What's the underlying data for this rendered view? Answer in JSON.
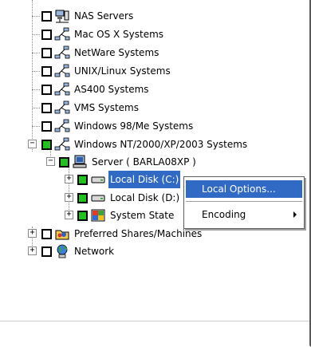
{
  "tree": {
    "items": [
      {
        "label": "NAS Servers",
        "icon": "network-computer-icon"
      },
      {
        "label": "Mac OS X Systems",
        "icon": "network-icon"
      },
      {
        "label": "NetWare Systems",
        "icon": "network-icon"
      },
      {
        "label": "UNIX/Linux Systems",
        "icon": "network-icon"
      },
      {
        "label": "AS400 Systems",
        "icon": "network-icon"
      },
      {
        "label": "VMS Systems",
        "icon": "network-icon"
      },
      {
        "label": "Windows 98/Me Systems",
        "icon": "network-icon"
      },
      {
        "label": "Windows NT/2000/XP/2003 Systems",
        "icon": "network-icon",
        "expander": "−"
      },
      {
        "label": "Server ( BARLA08XP )",
        "icon": "server-icon",
        "expander": "−"
      },
      {
        "label": "Local Disk (C:)",
        "icon": "disk-icon",
        "expander": "+",
        "selected": true
      },
      {
        "label": "Local Disk (D:)",
        "icon": "disk-icon",
        "expander": "+"
      },
      {
        "label": "System State",
        "icon": "system-state-icon",
        "expander": "+"
      },
      {
        "label": "Preferred Shares/Machines",
        "icon": "shared-folder-icon",
        "expander": "+"
      },
      {
        "label": "Network",
        "icon": "globe-network-icon",
        "expander": "+"
      }
    ]
  },
  "context_menu": {
    "items": [
      {
        "label": "Local Options..."
      },
      {
        "label": "Encoding"
      }
    ]
  },
  "colors": {
    "selection": "#316ac5",
    "checkbox_green": "#22c21e"
  }
}
